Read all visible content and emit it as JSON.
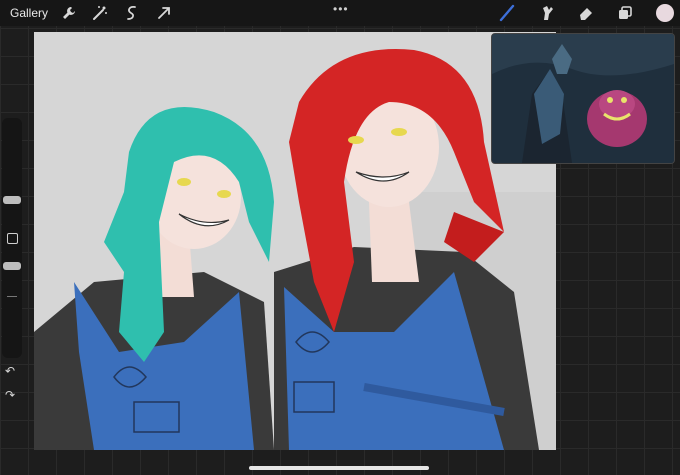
{
  "app": {
    "gallery_label": "Gallery",
    "menu_dots": "•••"
  },
  "toolbar_left": [
    {
      "name": "wrench-icon"
    },
    {
      "name": "magic-wand-icon"
    },
    {
      "name": "selection-icon"
    },
    {
      "name": "transform-arrow-icon"
    }
  ],
  "toolbar_right": [
    {
      "name": "brush-icon"
    },
    {
      "name": "smudge-icon"
    },
    {
      "name": "eraser-icon"
    },
    {
      "name": "layers-icon"
    },
    {
      "name": "color-swatch-icon"
    }
  ],
  "sidebar": {
    "undo_icon": "↶",
    "redo_icon": "↷"
  },
  "colors": {
    "brush_active": "#3d6fd9",
    "current_color": "#e8d9df",
    "canvas_bg": "#d6d6d6"
  }
}
